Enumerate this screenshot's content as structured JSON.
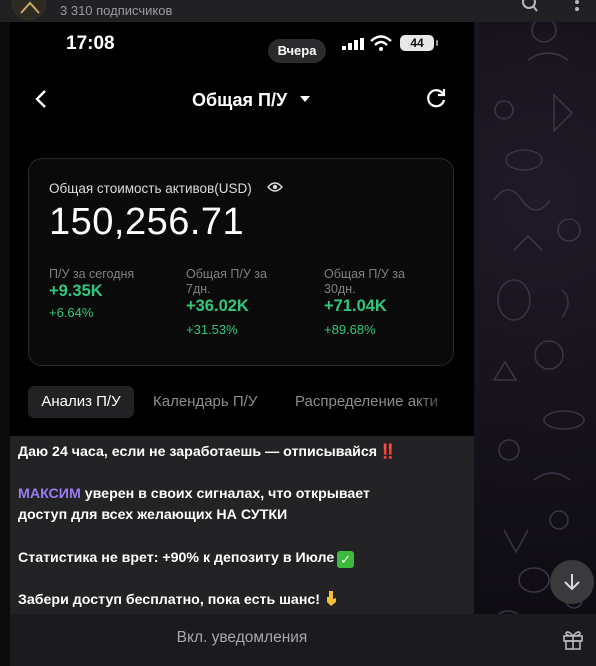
{
  "channel": {
    "subscribers": "3 310 подписчиков"
  },
  "screenshot": {
    "status_bar": {
      "time": "17:08",
      "pill": "Вчера",
      "battery": "44"
    },
    "nav": {
      "title": "Общая П/У"
    },
    "card": {
      "label": "Общая стоимость активов(USD)",
      "total": "150,256.71",
      "stats": [
        {
          "label": "П/У за сегодня",
          "value": "+9.35K",
          "percent": "+6.64%"
        },
        {
          "label": "Общая П/У за 7дн.",
          "value": "+36.02K",
          "percent": "+31.53%"
        },
        {
          "label": "Общая П/У за 30дн.",
          "value": "+71.04K",
          "percent": "+89.68%"
        }
      ]
    },
    "tabs": [
      "Анализ П/У",
      "Календарь П/У",
      "Распределение акти"
    ]
  },
  "message": {
    "line1": "Даю 24 часа, если не заработаешь — отписывайся",
    "line1_emoji": "‼️",
    "line2_name": "МАКСИМ",
    "line2_rest": " уверен в своих сигналах, что открывает",
    "line2b": "доступ для всех желающих НА СУТКИ",
    "line3": "Статистика не врет: +90% к депозиту в Июле",
    "line3_emoji": "✓",
    "line4": "Забери доступ бесплатно, пока есть шанс!"
  },
  "bottom_bar": {
    "notifications_label": "Вкл. уведомления"
  },
  "colors": {
    "accent_green": "#2fc87d",
    "name_purple": "#9b7cf0",
    "background": "#0e0c12"
  }
}
